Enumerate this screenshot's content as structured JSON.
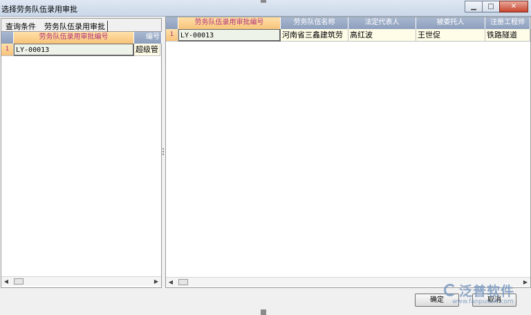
{
  "window": {
    "title": "选择劳务队伍录用审批",
    "min_icon": "minimize-icon",
    "max_icon": "maximize-icon",
    "close_icon": "close-icon"
  },
  "left_panel": {
    "tabs": [
      "查询条件",
      "劳务队伍录用审批"
    ],
    "columns": [
      "劳务队伍录用审批编号",
      "编号"
    ],
    "rows": [
      {
        "num": "1",
        "cells": [
          "LY-00013",
          "超级管"
        ]
      }
    ]
  },
  "right_panel": {
    "columns": [
      "劳务队伍录用审批编号",
      "劳务队伍名称",
      "法定代表人",
      "被委托人",
      "注册工程师"
    ],
    "rows": [
      {
        "num": "1",
        "cells": [
          "LY-00013",
          "河南省三鑫建筑劳",
          "高红波",
          "王世促",
          "铁路隧道"
        ]
      }
    ]
  },
  "footer": {
    "ok_label": "确定",
    "cancel_label": "取消"
  },
  "watermark": {
    "text": "泛普软件",
    "url": "www.fanpusoft.com"
  },
  "colors": {
    "header_bg": "#9aaac6",
    "selected_header": "#f7c37a",
    "row_bg": "#fffde7"
  }
}
